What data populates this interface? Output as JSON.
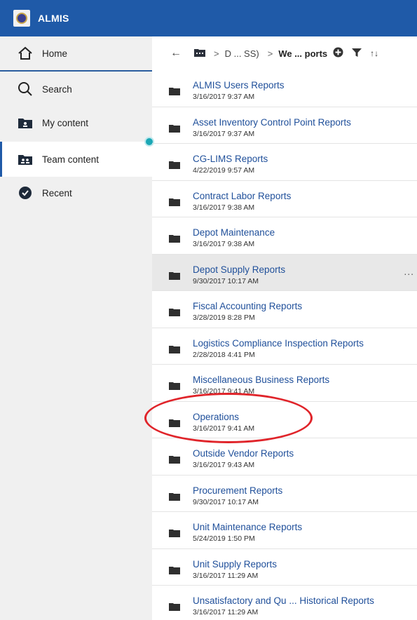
{
  "app": {
    "title": "ALMIS"
  },
  "sidebar": {
    "items": [
      {
        "label": "Home",
        "icon": "home-icon"
      },
      {
        "label": "Search",
        "icon": "search-icon"
      },
      {
        "label": "My content",
        "icon": "my-content-icon"
      },
      {
        "label": "Team content",
        "icon": "team-content-icon",
        "selected": true
      },
      {
        "label": "Recent",
        "icon": "recent-icon"
      }
    ]
  },
  "breadcrumb": {
    "back": "←",
    "sep": ">",
    "crumb1": "D ... SS)",
    "crumb2": "We ... ports",
    "sort": "↑↓"
  },
  "list": {
    "items": [
      {
        "name": "ALMIS Users Reports",
        "date": "3/16/2017 9:37 AM"
      },
      {
        "name": "Asset Inventory Control Point Reports",
        "date": "3/16/2017 9:37 AM"
      },
      {
        "name": "CG-LIMS Reports",
        "date": "4/22/2019 9:57 AM"
      },
      {
        "name": "Contract Labor Reports",
        "date": "3/16/2017 9:38 AM"
      },
      {
        "name": "Depot Maintenance",
        "date": "3/16/2017 9:38 AM"
      },
      {
        "name": "Depot Supply Reports",
        "date": "9/30/2017 10:17 AM",
        "more": "..."
      },
      {
        "name": "Fiscal Accounting Reports",
        "date": "3/28/2019 8:28 PM"
      },
      {
        "name": "Logistics Compliance Inspection Reports",
        "date": "2/28/2018 4:41 PM"
      },
      {
        "name": "Miscellaneous Business Reports",
        "date": "3/16/2017 9:41 AM"
      },
      {
        "name": "Operations",
        "date": "3/16/2017 9:41 AM"
      },
      {
        "name": "Outside Vendor Reports",
        "date": "3/16/2017 9:43 AM"
      },
      {
        "name": "Procurement Reports",
        "date": "9/30/2017 10:17 AM"
      },
      {
        "name": "Unit Maintenance Reports",
        "date": "5/24/2019 1:50 PM"
      },
      {
        "name": "Unit Supply Reports",
        "date": "3/16/2017 11:29 AM"
      },
      {
        "name": "Unsatisfactory and Qu ... Historical Reports",
        "date": "3/16/2017 11:29 AM"
      }
    ]
  },
  "colors": {
    "titlebar": "#1f5aa8",
    "link": "#1f4f9a",
    "annotation": "#e0242a",
    "notification_dot": "#1ba7b5"
  }
}
